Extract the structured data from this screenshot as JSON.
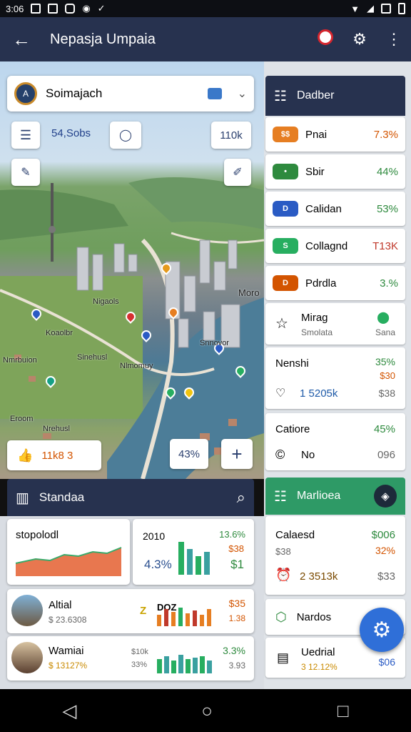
{
  "status_bar": {
    "time": "3:06"
  },
  "app_bar": {
    "title": "Nepasja Umpaia"
  },
  "search_card": {
    "logo_text": "A",
    "text": "Soimajach"
  },
  "map": {
    "price_label": "54,Sobs",
    "zoom_label": "110k",
    "labels": [
      "Moro",
      "Nigaols",
      "Koaolbr",
      "Nmrbuion",
      "Nlmomuy",
      "Sinehusl",
      "Nrehusl",
      "Eroom",
      "Snnovor"
    ],
    "chip_left": "11k8 3",
    "chip_mid": "43%",
    "plus": "+"
  },
  "panel": {
    "title": "Standaa"
  },
  "tiles": {
    "t1": {
      "title": "stopolodl"
    },
    "t2": {
      "title": "2010",
      "v1": "13.6%",
      "v2": "4.3%",
      "v3": "$38",
      "v4": "$1"
    },
    "r1": {
      "title": "Altial",
      "sub": "$ 23.6308",
      "tag": "Z",
      "tag2": "DOZ",
      "v1": "$35",
      "v2": "1.38"
    },
    "r2": {
      "title": "Wamiai",
      "sub": "$ 13127%",
      "l1": "$10k",
      "l2": "33%",
      "v1": "3.3%",
      "v2": "3.93"
    }
  },
  "right": {
    "header": {
      "title": "Dadber"
    },
    "rows": [
      {
        "label": "Pnai",
        "value": "7.3%",
        "badge": "$$",
        "color": "#d35400"
      },
      {
        "label": "Sbir",
        "value": "44%",
        "badge": "•",
        "color": "#2e8a3e"
      },
      {
        "label": "Calidan",
        "value": "53%",
        "badge": "D",
        "color": "#2e8a3e"
      },
      {
        "label": "Collagnd",
        "value": "T13K",
        "badge": "S",
        "color": "#c0392b"
      },
      {
        "label": "Pdrdla",
        "value": "3.%",
        "badge": "D",
        "color": "#2e8a3e"
      }
    ],
    "mirag": {
      "title": "Mirag",
      "sub": "Smolata",
      "side": "Sana"
    },
    "nenshi": {
      "title": "Nenshi",
      "v1": "35%",
      "v2": "$30",
      "amount": "1 5205k",
      "v3": "$38"
    },
    "catiore": {
      "title": "Catiore",
      "v1": "45%",
      "no": "No",
      "v2": "096"
    },
    "green_header": {
      "title": "Marlioea"
    },
    "calaesd": {
      "title": "Calaesd",
      "v1": "$006",
      "s": "$38",
      "v2": "32%",
      "amount": "2 3513k",
      "v3": "$33"
    },
    "nados": {
      "title": "Nardos"
    },
    "uedrial": {
      "title": "Uedrial",
      "sub": "3 12.12%",
      "v": "$06"
    }
  }
}
